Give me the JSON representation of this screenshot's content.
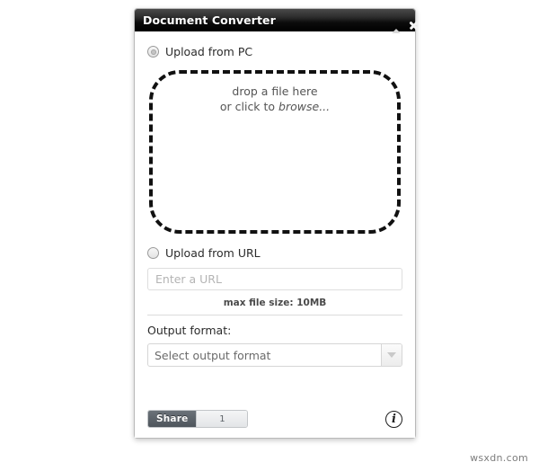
{
  "window": {
    "title": "Document Converter",
    "collapse_icon": "caret-up-icon",
    "close_icon": "close-icon"
  },
  "upload_pc": {
    "radio_label": "Upload from PC",
    "selected": true,
    "dropzone": {
      "line1": "drop a file here",
      "line2_prefix": "or click to ",
      "line2_emphasis": "browse..."
    }
  },
  "upload_url": {
    "radio_label": "Upload from URL",
    "selected": false,
    "input_value": "",
    "input_placeholder": "Enter a URL"
  },
  "max_file_size": "max file size: 10MB",
  "output": {
    "label": "Output format:",
    "selected_value": "Select output format",
    "arrow_icon": "chevron-down-icon"
  },
  "footer": {
    "share_label": "Share",
    "share_count": "1",
    "info_icon": "info-icon",
    "info_glyph": "i"
  },
  "watermark": "wsxdn.com"
}
